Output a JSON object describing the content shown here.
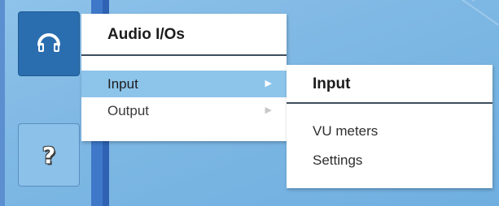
{
  "sidebar": {
    "buttons": [
      {
        "id": "audio",
        "icon": "headphones-icon"
      },
      {
        "id": "help",
        "icon": "question-mark-icon",
        "glyph": "?"
      }
    ]
  },
  "main_menu": {
    "title": "Audio I/Os",
    "items": [
      {
        "label": "Input",
        "submenu": true,
        "active": true,
        "chevron": "▶"
      },
      {
        "label": "Output",
        "submenu": true,
        "active": false,
        "chevron": "▶"
      }
    ]
  },
  "sub_menu": {
    "title": "Input",
    "items": [
      {
        "label": "VU meters"
      },
      {
        "label": "Settings"
      }
    ]
  },
  "colors": {
    "background": "#7fb8e4",
    "rail": "#3f78c9",
    "audio_button": "#2a6eb0",
    "active_item": "#8dc4ea",
    "menu_bg": "#ffffff",
    "title_border": "#3d4d5d"
  }
}
